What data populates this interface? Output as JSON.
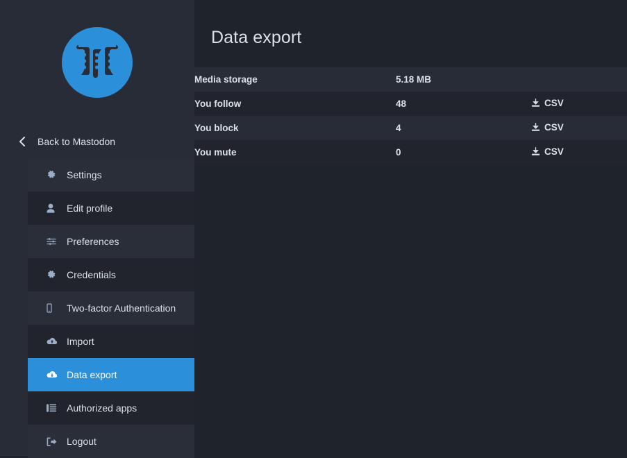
{
  "theme": {
    "sidebar_bg": "#282c37",
    "main_bg": "#1f232b",
    "accent": "#2b90d9",
    "text": "#d9e1e8",
    "muted_icon": "#9baec8",
    "row_odd": "#282c37",
    "row_even": "#21242d"
  },
  "sidebar": {
    "logo": {
      "name": "mastodon-logo",
      "circle_color": "#2b90d9",
      "glyph_color": "#282c37"
    },
    "back": {
      "label": "Back to Mastodon",
      "icon": "chevron-left-icon"
    },
    "items": [
      {
        "label": "Settings",
        "icon": "gear-icon",
        "active": false,
        "shade": "alt"
      },
      {
        "label": "Edit profile",
        "icon": "user-icon",
        "active": false,
        "shade": "dark"
      },
      {
        "label": "Preferences",
        "icon": "sliders-icon",
        "active": false,
        "shade": "alt"
      },
      {
        "label": "Credentials",
        "icon": "gear-icon",
        "active": false,
        "shade": "dark"
      },
      {
        "label": "Two-factor Authentication",
        "icon": "mobile-icon",
        "active": false,
        "shade": "alt"
      },
      {
        "label": "Import",
        "icon": "cloud-upload-icon",
        "active": false,
        "shade": "dark"
      },
      {
        "label": "Data export",
        "icon": "cloud-download-icon",
        "active": true,
        "shade": "active"
      },
      {
        "label": "Authorized apps",
        "icon": "list-icon",
        "active": false,
        "shade": "dark"
      },
      {
        "label": "Logout",
        "icon": "sign-out-icon",
        "active": false,
        "shade": "alt"
      }
    ]
  },
  "main": {
    "title": "Data export",
    "table": {
      "rows": [
        {
          "name": "Media storage",
          "value": "5.18 MB",
          "action": null,
          "action_icon": null
        },
        {
          "name": "You follow",
          "value": "48",
          "action": "CSV",
          "action_icon": "download-icon"
        },
        {
          "name": "You block",
          "value": "4",
          "action": "CSV",
          "action_icon": "download-icon"
        },
        {
          "name": "You mute",
          "value": "0",
          "action": "CSV",
          "action_icon": "download-icon"
        }
      ]
    }
  }
}
